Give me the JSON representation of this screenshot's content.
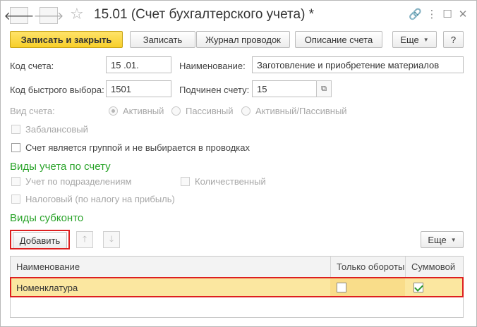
{
  "window": {
    "title": "15.01 (Счет бухгалтерского учета) *",
    "back_glyph": "🡐",
    "forward_glyph": "🡒",
    "star_glyph": "☆",
    "link_glyph": "🔗",
    "more_glyph": "⋮",
    "maximize_glyph": "☐",
    "close_glyph": "✕"
  },
  "toolbar": {
    "save_close": "Записать и закрыть",
    "save": "Записать",
    "journal": "Журнал проводок",
    "description": "Описание счета",
    "more": "Еще",
    "help": "?"
  },
  "form": {
    "account_code_label": "Код счета:",
    "account_code_value": "15 .01.",
    "name_label": "Наименование:",
    "name_value": "Заготовление и приобретение материалов",
    "quick_code_label": "Код быстрого выбора:",
    "quick_code_value": "1501",
    "parent_label": "Подчинен счету:",
    "parent_value": "15",
    "account_type_label": "Вид счета:",
    "type_active": "Активный",
    "type_passive": "Пассивный",
    "type_active_passive": "Активный/Пассивный",
    "off_balance": "Забалансовый",
    "is_group": "Счет является группой и не выбирается в проводках"
  },
  "accounting_types": {
    "heading": "Виды учета по счету",
    "by_department": "Учет по подразделениям",
    "quantitative": "Количественный",
    "tax": "Налоговый (по налогу на прибыль)"
  },
  "subconto": {
    "heading": "Виды субконто",
    "add_button": "Добавить",
    "more_button": "Еще",
    "up_glyph": "🡑",
    "down_glyph": "🡓",
    "columns": {
      "name": "Наименование",
      "turnover_only": "Только обороты",
      "sum": "Суммовой"
    },
    "rows": [
      {
        "name": "Номенклатура",
        "turnover_only": false,
        "sum": true
      }
    ]
  },
  "colors": {
    "primary_button": "#f7cf2a",
    "section_heading": "#29a329",
    "highlight": "#dd1f1f",
    "selected_row": "#fbe7a0"
  }
}
